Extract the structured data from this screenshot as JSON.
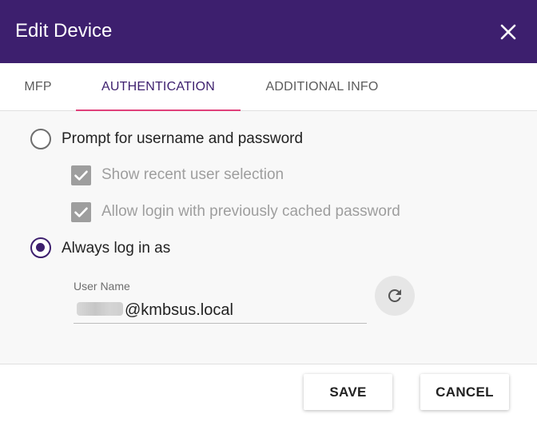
{
  "dialog": {
    "title": "Edit Device",
    "close_icon": "close-icon"
  },
  "tabs": [
    {
      "label": "MFP",
      "active": false
    },
    {
      "label": "AUTHENTICATION",
      "active": true
    },
    {
      "label": "ADDITIONAL INFO",
      "active": false
    }
  ],
  "auth": {
    "prompt_option": {
      "label": "Prompt for username and password",
      "selected": false
    },
    "sub_options": [
      {
        "label": "Show recent user selection",
        "checked": true,
        "disabled": true
      },
      {
        "label": "Allow login with previously cached password",
        "checked": true,
        "disabled": true
      }
    ],
    "always_option": {
      "label": "Always log in as",
      "selected": true
    },
    "username": {
      "label": "User Name",
      "value_suffix": "@kmbsus.local",
      "value_prefix_redacted": true
    },
    "refresh_icon": "refresh-icon"
  },
  "footer": {
    "save_label": "SAVE",
    "cancel_label": "CANCEL"
  },
  "colors": {
    "header": "#3d1f6e",
    "tab_indicator": "#e0407a",
    "active_tab_text": "#3d1f6e",
    "disabled_checkbox": "#9e9e9e"
  }
}
